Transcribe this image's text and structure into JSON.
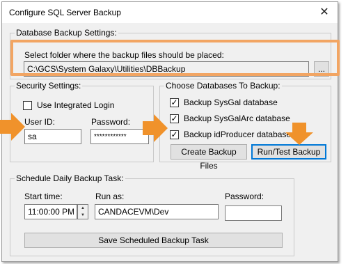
{
  "window": {
    "title": "Configure SQL Server Backup",
    "close_glyph": "✕"
  },
  "db_backup": {
    "legend": "Database Backup Settings:",
    "folder_label": "Select folder where the backup files should be placed:",
    "folder_value": "C:\\GCS\\System Galaxy\\Utilities\\DBBackup",
    "browse_label": "..."
  },
  "security": {
    "legend": "Security Settings:",
    "integrated_login_label": "Use Integrated Login",
    "integrated_login_checked": false,
    "user_id_label": "User ID:",
    "user_id_value": "sa",
    "password_label": "Password:",
    "password_value": "************"
  },
  "databases": {
    "legend": "Choose Databases To Backup:",
    "items": [
      {
        "label": "Backup SysGal database",
        "checked": true
      },
      {
        "label": "Backup SysGalArc database",
        "checked": true
      },
      {
        "label": "Backup idProducer database",
        "checked": true
      }
    ],
    "create_button": "Create Backup Files",
    "run_test_button": "Run/Test Backup"
  },
  "schedule": {
    "legend": "Schedule Daily Backup Task:",
    "start_time_label": "Start time:",
    "start_time_value": "11:00:00 PM",
    "run_as_label": "Run as:",
    "run_as_value": "CANDACEVM\\Dev",
    "password_label": "Password:",
    "password_value": "",
    "save_button": "Save Scheduled Backup Task"
  },
  "annotation_color": "#f2a563",
  "arrow_color": "#f0922b"
}
